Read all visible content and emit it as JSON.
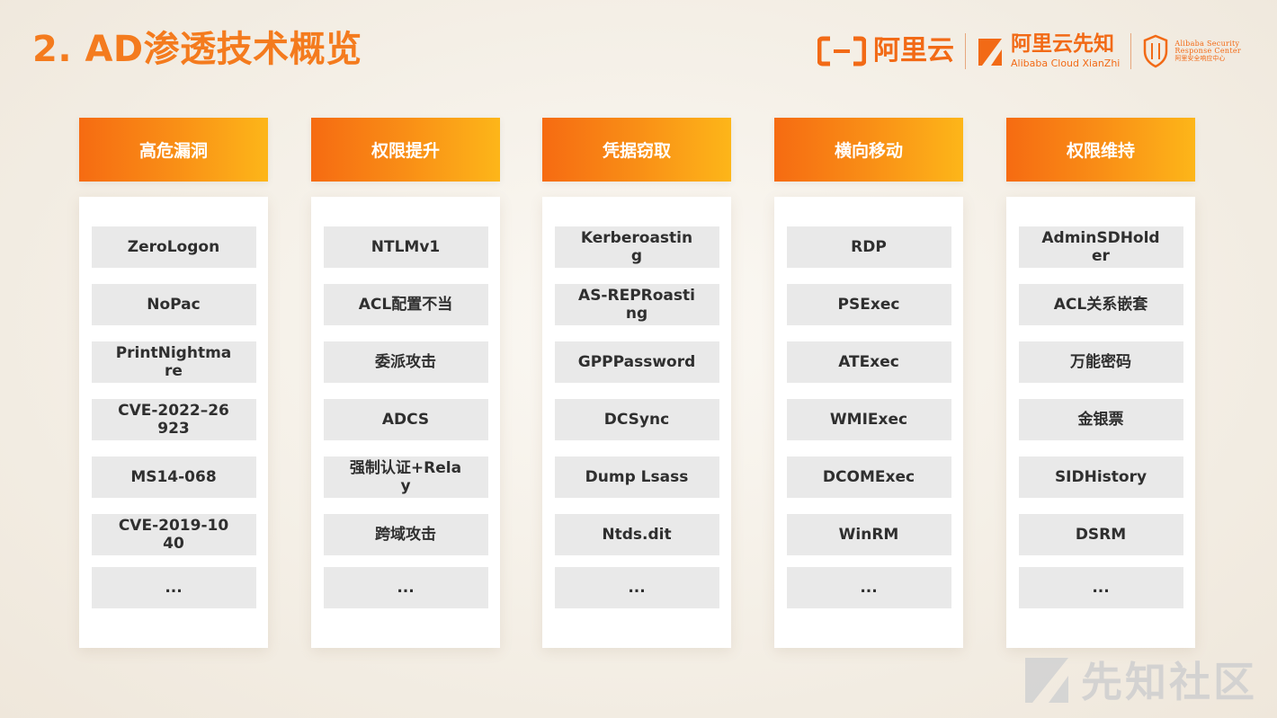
{
  "title": "2. AD渗透技术概览",
  "logos": {
    "aliyun": "阿里云",
    "xianzhi_cn": "阿里云先知",
    "xianzhi_en": "Alibaba Cloud XianZhi",
    "asrc_line1": "Alibaba Security",
    "asrc_line2": "Response Center",
    "asrc_cn": "阿里安全响应中心"
  },
  "columns": [
    {
      "header": "高危漏洞",
      "items": [
        "ZeroLogon",
        "NoPac",
        "PrintNightmare",
        "CVE-2022–26923",
        "MS14-068",
        "CVE-2019-1040",
        "..."
      ]
    },
    {
      "header": "权限提升",
      "items": [
        "NTLMv1",
        "ACL配置不当",
        "委派攻击",
        "ADCS",
        "强制认证+Relay",
        "跨域攻击",
        "..."
      ]
    },
    {
      "header": "凭据窃取",
      "items": [
        "Kerberoasting",
        "AS-REPRoasting",
        "GPPPassword",
        "DCSync",
        "Dump Lsass",
        "Ntds.dit",
        "..."
      ]
    },
    {
      "header": "横向移动",
      "items": [
        "RDP",
        "PSExec",
        "ATExec",
        "WMIExec",
        "DCOMExec",
        "WinRM",
        "..."
      ]
    },
    {
      "header": "权限维持",
      "items": [
        "AdminSDHolder",
        "ACL关系嵌套",
        "万能密码",
        "金银票",
        "SIDHistory",
        "DSRM",
        "..."
      ]
    }
  ],
  "watermark": "先知社区",
  "colors": {
    "accent": "#f47b1e",
    "header_gradient_start": "#f66b12",
    "header_gradient_end": "#fdb619",
    "item_bg": "#e9e9e9"
  }
}
